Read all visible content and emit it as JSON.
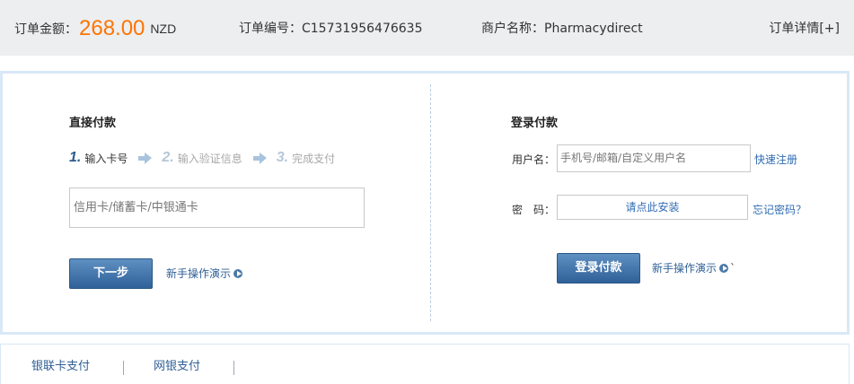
{
  "order_bar": {
    "amount_label": "订单金额：",
    "amount_value": "268.00",
    "currency": "NZD",
    "order_no_label": "订单编号：",
    "order_no": "C15731956476635",
    "merchant_label": "商户名称：",
    "merchant": "Pharmacydirect",
    "detail_link": "订单详情[+]"
  },
  "direct_pay": {
    "title": "直接付款",
    "steps": [
      {
        "num": "1.",
        "label": "输入卡号"
      },
      {
        "num": "2.",
        "label": "输入验证信息"
      },
      {
        "num": "3.",
        "label": "完成支付"
      }
    ],
    "card_placeholder": "信用卡/储蓄卡/中银通卡",
    "next_button": "下一步",
    "demo_link": "新手操作演示"
  },
  "login_pay": {
    "title": "登录付款",
    "username_label": "用户名：",
    "username_placeholder": "手机号/邮箱/自定义用户名",
    "register_link": "快速注册",
    "password_label": "密　码：",
    "password_install": "请点此安装",
    "forgot_link": "忘记密码？",
    "login_button": "登录付款",
    "demo_link": "新手操作演示",
    "trailing_mark": "`"
  },
  "bottom_tabs": [
    {
      "label": "银联卡支付"
    },
    {
      "label": "网银支付"
    }
  ],
  "colors": {
    "amount": "#ff7400",
    "link": "#2f6bb3",
    "button": "#3a6ea5",
    "panel_border": "#d9e8f6"
  }
}
